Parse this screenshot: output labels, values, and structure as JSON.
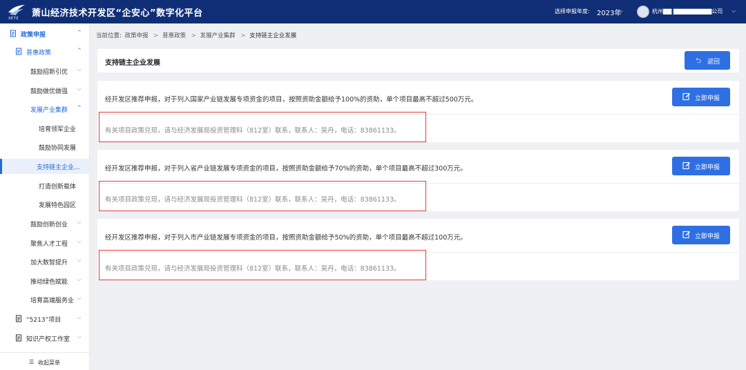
{
  "header": {
    "logo_text": "XETZ",
    "title": "萧山经济技术开发区“企安心”数字化平台",
    "year_label": "选择申报年度:",
    "year_value": "2023年",
    "company": "杭州▇▇ ▇▇▇▇▇▇▇▇▇公司"
  },
  "sidebar": {
    "items": [
      {
        "label": "政策申报"
      },
      {
        "label": "普惠政策"
      },
      {
        "label": "鼓励招新引优"
      },
      {
        "label": "鼓励做优做强"
      },
      {
        "label": "发展产业集群"
      },
      {
        "label": "培育领军企业"
      },
      {
        "label": "鼓励协同发展"
      },
      {
        "label": "支持链主企业..."
      },
      {
        "label": "打造创新载体"
      },
      {
        "label": "发展特色园区"
      },
      {
        "label": "鼓励创新创业"
      },
      {
        "label": "聚焦人才工程"
      },
      {
        "label": "加大数智提升"
      },
      {
        "label": "推动绿色赋能"
      },
      {
        "label": "培育高端服务业"
      },
      {
        "label": "“5213”项目"
      },
      {
        "label": "知识产权工作室"
      }
    ],
    "collapse_label": "收起菜单"
  },
  "breadcrumb": {
    "prefix": "当前位置:",
    "items": [
      "政策申报",
      "普惠政策",
      "发展产业集群",
      "支持链主企业发展"
    ]
  },
  "page": {
    "title": "支持链主企业发展",
    "back_label": "返回"
  },
  "policies": [
    {
      "desc": "经开发区推荐申报，对于列入国家产业链发展专项资金的项目，按照资助金额给予100%的资助，单个项目最高不超过500万元。",
      "contact": "有关项目政策兑现，请与经济发展局投资管理科（812室）联系，联系人：吴丹，电话：83861133。",
      "button": "立即申报"
    },
    {
      "desc": "经开发区推荐申报，对于列入省产业链发展专项资金的项目，按照资助金额给予70%的资助，单个项目最高不超过300万元。",
      "contact": "有关项目政策兑现，请与经济发展局投资管理科（812室）联系，联系人：吴丹，电话：83861133。",
      "button": "立即申报"
    },
    {
      "desc": "经开发区推荐申报，对于列入市产业链发展专项资金的项目，按照资助金额给予50%的资助，单个项目最高不超过100万元。",
      "contact": "有关项目政策兑现，请与经济发展局投资管理科（812室）联系，联系人：吴丹，电话：83861133。",
      "button": "立即申报"
    }
  ],
  "colors": {
    "header_bg": "#102e76",
    "accent": "#2f6fe4",
    "active_text": "#1f6bd8",
    "highlight_border": "#e13c3c"
  }
}
